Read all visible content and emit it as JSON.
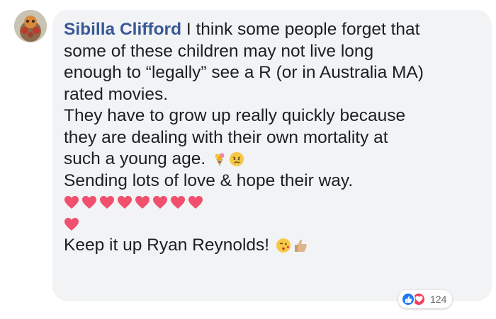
{
  "comment": {
    "author": "Sibilla Clifford",
    "line1_rest": " I think some people forget that",
    "para1_lines": [
      "some of these children may not live long",
      "enough to “legally” see a R (or in Australia MA)",
      "rated movies."
    ],
    "para2_lines": [
      "They have to grow up really quickly because",
      "they are dealing with their own mortality at"
    ],
    "para2_last": "such a young age.",
    "para2_emojis": [
      "bouquet-emoji",
      "crying-face-emoji"
    ],
    "para3": "Sending lots of love & hope their way.",
    "hearts_row1_count": 8,
    "hearts_row2_count": 1,
    "closing": "Keep it up Ryan Reynolds!",
    "closing_emojis": [
      "face-blowing-kiss-emoji",
      "thumbs-up-emoji"
    ]
  },
  "reactions": {
    "icons": [
      "like-icon",
      "love-icon"
    ],
    "count": "124"
  },
  "colors": {
    "author": "#385898",
    "text": "#1c1e21",
    "bubble": "#f2f3f5",
    "heart": "#f0506e",
    "like": "#2078f4",
    "love": "#f33e58",
    "count": "#65676b"
  }
}
